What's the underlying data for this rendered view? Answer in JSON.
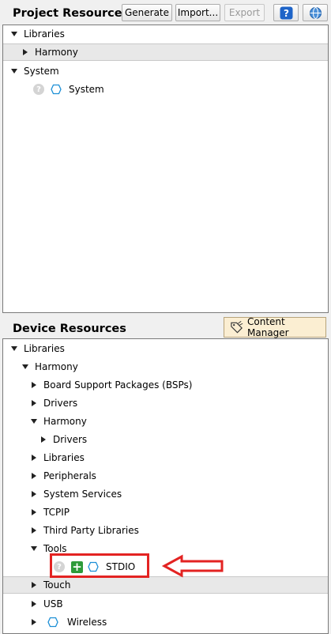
{
  "project_resources": {
    "title": "Project Resources",
    "buttons": {
      "generate": "Generate",
      "import": "Import...",
      "export": "Export"
    },
    "tree": {
      "libraries": "Libraries",
      "harmony": "Harmony",
      "system_group": "System",
      "system_item": "System"
    }
  },
  "device_resources": {
    "title": "Device Resources",
    "content_manager": "Content Manager",
    "tree": {
      "libraries": "Libraries",
      "harmony": "Harmony",
      "bsps": "Board Support Packages (BSPs)",
      "drivers": "Drivers",
      "harmony_sub": "Harmony",
      "harmony_drivers": "Drivers",
      "libraries_sub": "Libraries",
      "peripherals": "Peripherals",
      "system_services": "System Services",
      "tcpip": "TCPIP",
      "third_party": "Third Party Libraries",
      "tools": "Tools",
      "stdio": "STDIO",
      "touch": "Touch",
      "usb": "USB",
      "wireless": "Wireless"
    }
  },
  "colors": {
    "annotation_red": "#e32322",
    "help_blue": "#1e64c8",
    "plus_green": "#2e9b3a",
    "hex_blue": "#1c8fd6"
  },
  "icons": [
    "help-icon",
    "globe-icon",
    "hex-component-icon",
    "question-icon",
    "plus-icon",
    "content-manager-icon",
    "red-arrow"
  ]
}
